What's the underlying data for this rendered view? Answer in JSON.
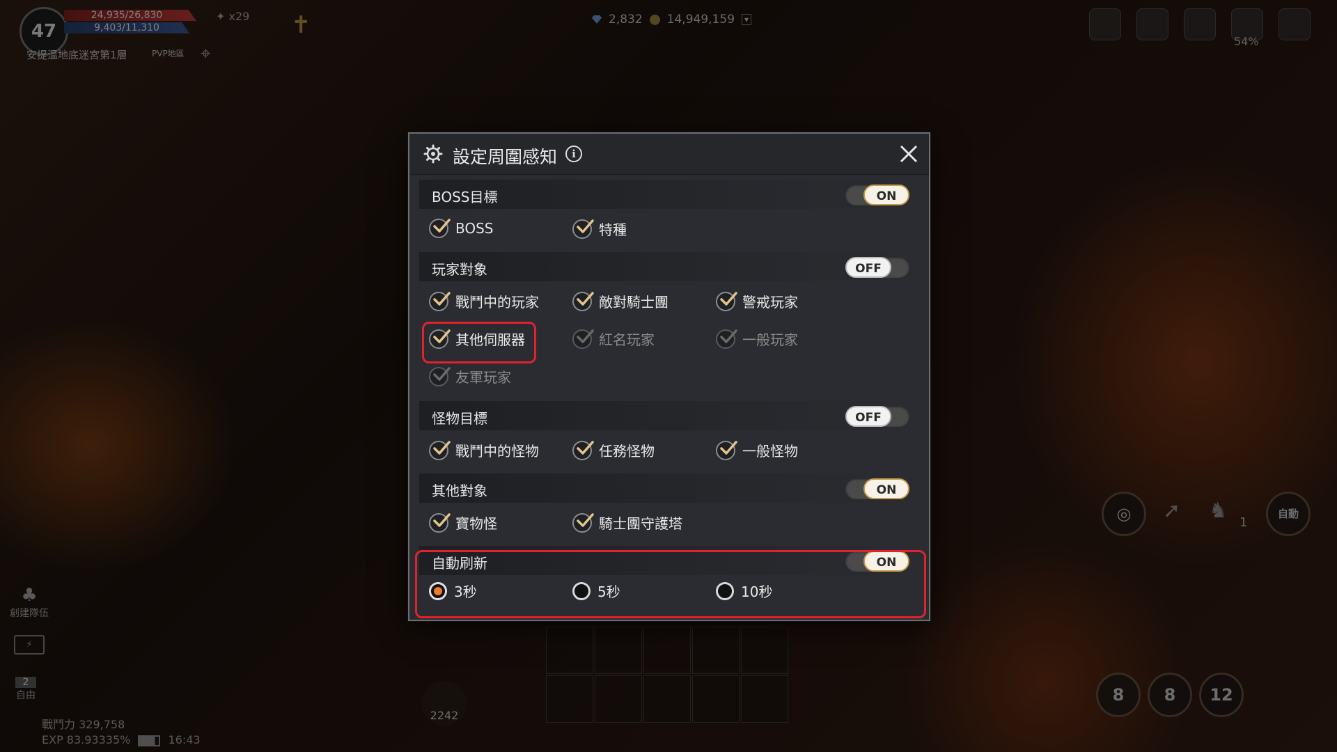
{
  "hud": {
    "level": "47",
    "hp": "24,935/26,830",
    "mp": "9,403/11,310",
    "buff_count": "x29",
    "map_name": "安提温地底迷宮第1層",
    "map_zone": "PVP地區",
    "diamonds": "2,832",
    "gold": "14,949,159",
    "weight": "54%",
    "combat_power": "戰鬥力 329,758",
    "exp": "EXP 83.93335%",
    "clock": "16:43",
    "create_party": "創建隊伍",
    "mode": "自由",
    "mode_number": "2",
    "auto_label": "自動",
    "potion_count": "2242",
    "skill_counts": [
      "8",
      "8",
      "12"
    ],
    "target_count": "1"
  },
  "dialog": {
    "title": "設定周圍感知",
    "sections": [
      {
        "title": "BOSS目標",
        "toggle": "ON",
        "options": [
          {
            "label": "BOSS",
            "checked": true
          },
          {
            "label": "特種",
            "checked": true
          }
        ]
      },
      {
        "title": "玩家對象",
        "toggle": "OFF",
        "options": [
          {
            "label": "戰鬥中的玩家",
            "checked": true
          },
          {
            "label": "敵對騎士團",
            "checked": true
          },
          {
            "label": "警戒玩家",
            "checked": true
          },
          {
            "label": "其他伺服器",
            "checked": true
          },
          {
            "label": "紅名玩家",
            "checked": false
          },
          {
            "label": "一般玩家",
            "checked": false
          },
          {
            "label": "友軍玩家",
            "checked": false
          }
        ]
      },
      {
        "title": "怪物目標",
        "toggle": "OFF",
        "options": [
          {
            "label": "戰鬥中的怪物",
            "checked": true
          },
          {
            "label": "任務怪物",
            "checked": true
          },
          {
            "label": "一般怪物",
            "checked": true
          }
        ]
      },
      {
        "title": "其他對象",
        "toggle": "ON",
        "options": [
          {
            "label": "寶物怪",
            "checked": true
          },
          {
            "label": "騎士團守護塔",
            "checked": true
          }
        ]
      },
      {
        "title": "自動刷新",
        "toggle": "ON",
        "radios": [
          {
            "label": "3秒",
            "selected": true
          },
          {
            "label": "5秒",
            "selected": false
          },
          {
            "label": "10秒",
            "selected": false
          }
        ]
      }
    ]
  },
  "colors": {
    "toggle_on_border": "#c79d4a",
    "radio_selected": "#ef7a2a",
    "highlight": "#e0232e",
    "check_active": "#e3c58a"
  }
}
